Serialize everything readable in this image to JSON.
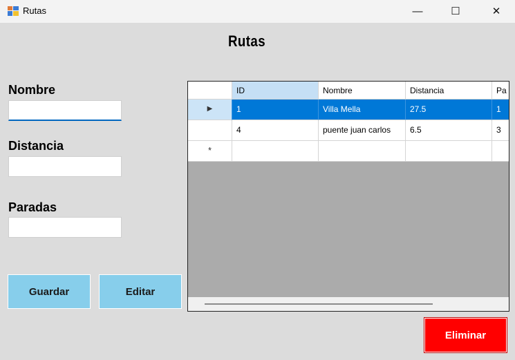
{
  "window": {
    "title": "Rutas",
    "minimize": "—",
    "maximize": "☐",
    "close": "✕"
  },
  "form": {
    "title": "Rutas",
    "fields": {
      "nombre": {
        "label": "Nombre",
        "value": ""
      },
      "distancia": {
        "label": "Distancia",
        "value": ""
      },
      "paradas": {
        "label": "Paradas",
        "value": ""
      }
    },
    "buttons": {
      "guardar": "Guardar",
      "editar": "Editar",
      "eliminar": "Eliminar"
    }
  },
  "grid": {
    "columns": [
      "ID",
      "Nombre",
      "Distancia",
      "Pa"
    ],
    "rows": [
      {
        "marker": "▶",
        "cells": [
          "1",
          "Villa Mella",
          "27.5",
          "1"
        ],
        "selected": true
      },
      {
        "marker": "",
        "cells": [
          "4",
          "puente juan carlos",
          "6.5",
          "3"
        ],
        "selected": false
      }
    ],
    "new_row_marker": "*"
  },
  "colors": {
    "button": "#87ceeb",
    "delete_button": "#ff0000",
    "selection": "#0078d7"
  }
}
